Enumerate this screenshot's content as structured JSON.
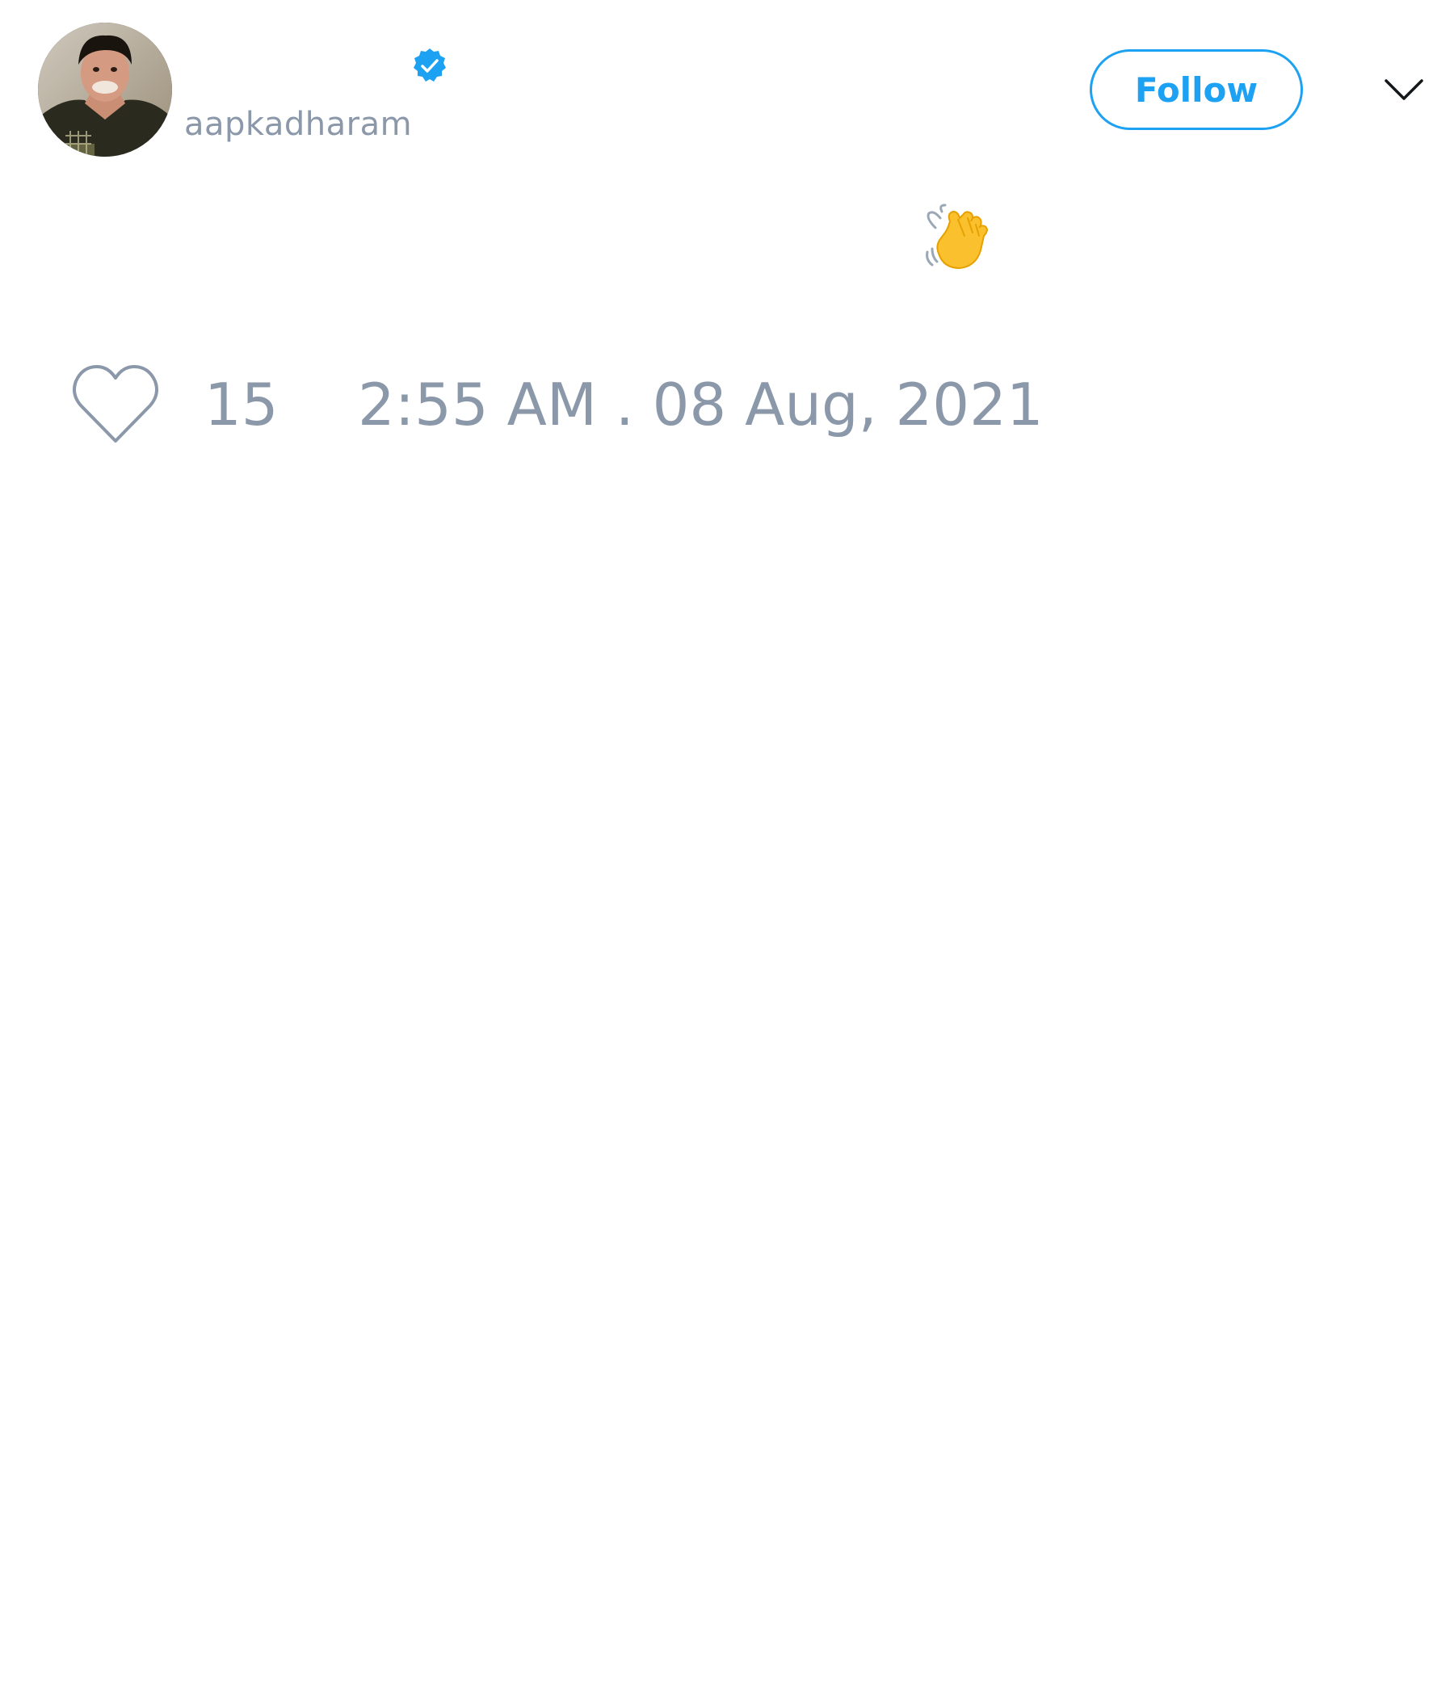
{
  "tweet": {
    "author": {
      "display_name": "",
      "handle": "aapkadharam",
      "verified": true
    },
    "text": "",
    "emoji": "waving-hand",
    "likes": "15",
    "timestamp": "2:55 AM . 08 Aug, 2021"
  },
  "actions": {
    "follow_label": "Follow"
  },
  "icons": {
    "verified": "verified-badge-icon",
    "menu": "chevron-down-icon",
    "like": "heart-icon"
  },
  "colors": {
    "accent": "#1da1f2",
    "muted_text": "#8b98a9",
    "primary_text": "#14171a",
    "background": "#ffffff"
  }
}
